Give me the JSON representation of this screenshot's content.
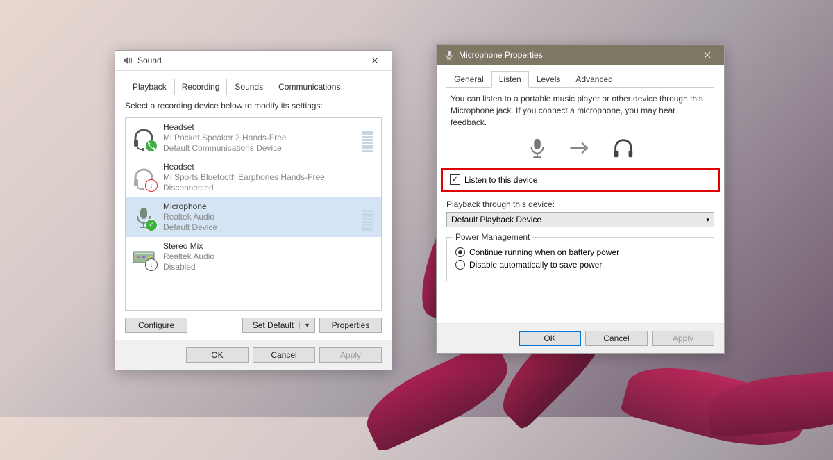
{
  "sound_window": {
    "title": "Sound",
    "tabs": [
      "Playback",
      "Recording",
      "Sounds",
      "Communications"
    ],
    "active_tab_index": 1,
    "instruction": "Select a recording device below to modify its settings:",
    "devices": [
      {
        "name": "Headset",
        "line2": "Mi Pocket Speaker 2 Hands-Free",
        "line3": "Default Communications Device"
      },
      {
        "name": "Headset",
        "line2": "Mi Sports Bluetooth Earphones Hands-Free",
        "line3": "Disconnected"
      },
      {
        "name": "Microphone",
        "line2": "Realtek Audio",
        "line3": "Default Device"
      },
      {
        "name": "Stereo Mix",
        "line2": "Realtek Audio",
        "line3": "Disabled"
      }
    ],
    "configure": "Configure",
    "set_default": "Set Default",
    "properties": "Properties",
    "ok": "OK",
    "cancel": "Cancel",
    "apply": "Apply"
  },
  "mic_window": {
    "title": "Microphone Properties",
    "tabs": [
      "General",
      "Listen",
      "Levels",
      "Advanced"
    ],
    "active_tab_index": 1,
    "description": "You can listen to a portable music player or other device through this Microphone jack.  If you connect a microphone, you may hear feedback.",
    "listen_checkbox": "Listen to this device",
    "listen_checked": true,
    "playback_label": "Playback through this device:",
    "playback_value": "Default Playback Device",
    "power_group": "Power Management",
    "radio1": "Continue running when on battery power",
    "radio2": "Disable automatically to save power",
    "radio_selected": 0,
    "ok": "OK",
    "cancel": "Cancel",
    "apply": "Apply"
  }
}
